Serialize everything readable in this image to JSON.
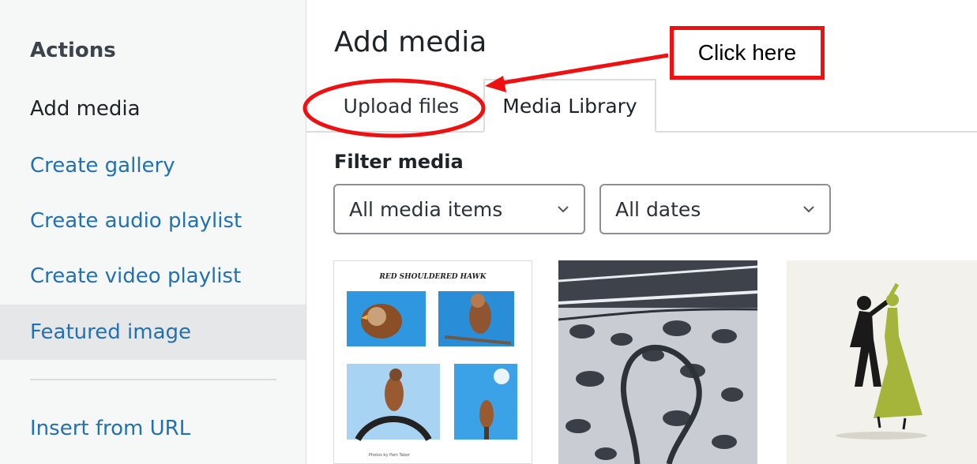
{
  "sidebar": {
    "heading": "Actions",
    "current": "Add media",
    "links": [
      "Create gallery",
      "Create audio playlist",
      "Create video playlist",
      "Featured image"
    ],
    "insert_url": "Insert from URL"
  },
  "main": {
    "title": "Add media",
    "tabs": [
      {
        "label": "Upload files"
      },
      {
        "label": "Media Library"
      }
    ],
    "filter": {
      "label": "Filter media",
      "type_selected": "All media items",
      "date_selected": "All dates"
    },
    "attachments": [
      {
        "title": "RED SHOULDERED HAWK",
        "caption": "Photos by Pam Tabor"
      },
      {},
      {}
    ]
  },
  "annotation": {
    "callout": "Click here",
    "color": "#ee1111"
  }
}
